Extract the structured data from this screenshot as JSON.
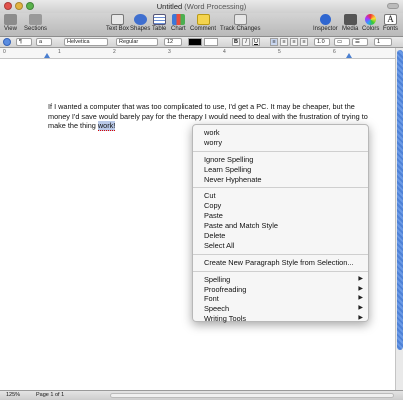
{
  "window": {
    "title": "Untitled",
    "subtitle": "(Word Processing)"
  },
  "toolbar": {
    "left_buttons": [
      {
        "label": "View",
        "icon": "view-icon"
      },
      {
        "label": "Sections",
        "icon": "sections-icon"
      }
    ],
    "center_buttons": [
      {
        "label": "Text Box",
        "icon": "text-box-icon"
      },
      {
        "label": "Shapes",
        "icon": "shapes-icon"
      },
      {
        "label": "Table",
        "icon": "table-icon"
      },
      {
        "label": "Chart",
        "icon": "chart-icon"
      },
      {
        "label": "Comment",
        "icon": "comment-icon"
      },
      {
        "label": "Track Changes",
        "icon": "track-changes-icon"
      }
    ],
    "right_buttons": [
      {
        "label": "Inspector",
        "icon": "inspector-icon"
      },
      {
        "label": "Media",
        "icon": "media-icon"
      },
      {
        "label": "Colors",
        "icon": "colors-icon"
      },
      {
        "label": "Fonts",
        "icon": "fonts-icon"
      }
    ]
  },
  "format_bar": {
    "font": "Helvetica",
    "style": "Regular",
    "size": "12",
    "bold": "B",
    "italic": "I",
    "underline": "U",
    "line_spacing": "1.0",
    "columns": "1"
  },
  "ruler": {
    "numbers": [
      "0",
      "1",
      "2",
      "3",
      "4",
      "5",
      "6"
    ]
  },
  "document": {
    "text_before": "If I wanted a computer that was too complicated to use, I'd get a PC. It may be cheaper, but the money I'd save would barely pay for the therapy I would need to deal with the frustration of trying to make the thing ",
    "misspelled_word": "work!"
  },
  "context_menu": {
    "suggestions": [
      "work",
      "worry"
    ],
    "spelling_actions": [
      "Ignore Spelling",
      "Learn Spelling",
      "Never Hyphenate"
    ],
    "edit_actions": [
      "Cut",
      "Copy",
      "Paste",
      "Paste and Match Style",
      "Delete",
      "Select All"
    ],
    "style_action": "Create New Paragraph Style from Selection...",
    "submenus": [
      "Spelling",
      "Proofreading",
      "Font",
      "Speech",
      "Writing Tools"
    ]
  },
  "status_bar": {
    "zoom": "125%",
    "page": "Page 1 of 1"
  },
  "colors": {
    "selection": "#b9c9e8",
    "scroll_thumb": "#6b9ae6"
  }
}
